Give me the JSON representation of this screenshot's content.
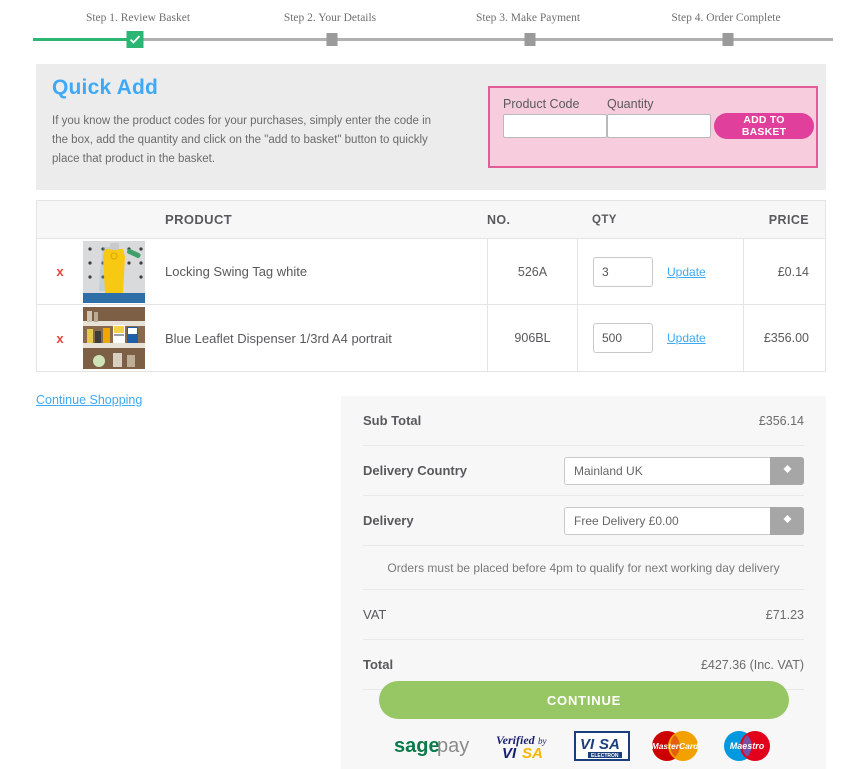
{
  "steps": {
    "items": [
      {
        "label": "Step 1. Review Basket",
        "state": "complete"
      },
      {
        "label": "Step 2. Your Details",
        "state": "pending"
      },
      {
        "label": "Step 3. Make Payment",
        "state": "pending"
      },
      {
        "label": "Step 4. Order Complete",
        "state": "pending"
      }
    ],
    "complete_color": "#2bb673",
    "pending_color": "#9a9a9a"
  },
  "quick_add": {
    "title": "Quick Add",
    "description": "If you know the product codes for your purchases, simply enter the code in the box, add the quantity and click on the \"add to basket\" button to quickly place that product in the basket.",
    "product_code_label": "Product Code",
    "product_code_value": "",
    "quantity_label": "Quantity",
    "quantity_value": "",
    "add_button": "ADD TO BASKET",
    "accent_color": "#e0409b",
    "panel_color": "#f7cddd"
  },
  "basket": {
    "headers": {
      "product": "PRODUCT",
      "no": "NO.",
      "qty": "QTY",
      "price": "PRICE"
    },
    "remove_label": "x",
    "update_label": "Update",
    "rows": [
      {
        "name": "Locking Swing Tag white",
        "code": "526A",
        "qty": "3",
        "price": "£0.14",
        "image": "yellow-swing-tag-photo"
      },
      {
        "name": "Blue Leaflet Dispenser 1/3rd A4 portrait",
        "code": "906BL",
        "qty": "500",
        "price": "£356.00",
        "image": "leaflet-dispenser-shelf-photo"
      }
    ]
  },
  "continue_shopping": "Continue Shopping",
  "summary": {
    "sub_total_label": "Sub Total",
    "sub_total_value": "£356.14",
    "delivery_country_label": "Delivery Country",
    "delivery_country_value": "Mainland UK",
    "delivery_label": "Delivery",
    "delivery_value": "Free Delivery £0.00",
    "note": "Orders must be placed before 4pm to qualify for next working day delivery",
    "vat_label": "VAT",
    "vat_value": "£71.23",
    "total_label": "Total",
    "total_value": "£427.36 (Inc. VAT)",
    "continue_button": "CONTINUE",
    "continue_color": "#97c765"
  },
  "payment_logos": [
    {
      "name": "sagepay-logo",
      "text": "sage",
      "text2": "pay"
    },
    {
      "name": "verified-by-visa-logo",
      "text": "Verified by",
      "text2": "VISA"
    },
    {
      "name": "visa-electron-logo",
      "text": "VISA",
      "text2": "ELECTRON"
    },
    {
      "name": "mastercard-logo",
      "text": "MasterCard"
    },
    {
      "name": "maestro-logo",
      "text": "Maestro"
    }
  ]
}
